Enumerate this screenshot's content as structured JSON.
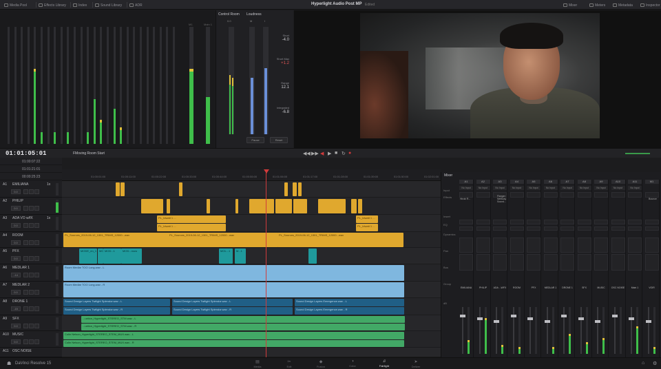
{
  "topbar": {
    "items": [
      "Media Pool",
      "Effects Library",
      "Index",
      "Sound Library",
      "ADR"
    ],
    "project_title": "Hyperlight Audio Post MP",
    "status": "Edited",
    "right_items": [
      "Mixer",
      "Meters",
      "Metadata",
      "Inspector"
    ]
  },
  "control_room": {
    "tab1": "Control Room",
    "tab2": "Loudness",
    "scale_top": "0.0",
    "m_label": "M",
    "i_label": "I",
    "short_label": "Short",
    "short_value": "-4.0",
    "short_max_label": "Short Max",
    "short_max_value": "+1.2",
    "range_label": "Range",
    "range_value": "12.1",
    "integrated_label": "Integrated",
    "integrated_value": "-6.8",
    "pause_label": "Pause",
    "reset_label": "Reset"
  },
  "meters": {
    "main_label": "M1",
    "bus_label": "Main 1"
  },
  "timeline": {
    "timecode": "01:01:05:01",
    "name": "FMoving Room Start",
    "tc_rows": [
      "01:00:07:22",
      "01:01:21:01",
      "00:00:25:23"
    ],
    "ruler": [
      "01:00:01:00",
      "01:00:11:00",
      "01:00:22:00",
      "01:00:33:00",
      "01:00:44:00",
      "01:00:55:00",
      "01:01:06:00",
      "01:01:17:00",
      "01:01:28:00",
      "01:01:39:00",
      "01:01:50:00",
      "01:02:01:00"
    ]
  },
  "tracks": [
    {
      "id": "A1",
      "name": "EMILIANA",
      "fmt": "1x",
      "vol": "0.0"
    },
    {
      "id": "A2",
      "name": "PHILIP",
      "fmt": "",
      "vol": "0.0"
    },
    {
      "id": "A3",
      "name": "ADA VO w/fX",
      "fmt": "1x",
      "vol": "0.0"
    },
    {
      "id": "A4",
      "name": "ROOM",
      "fmt": "",
      "vol": "0.0"
    },
    {
      "id": "A5",
      "name": "PFX",
      "fmt": "",
      "vol": "0.0"
    },
    {
      "id": "A6",
      "name": "MEDLAR 1",
      "fmt": "",
      "vol": "-14"
    },
    {
      "id": "A7",
      "name": "MEDLAR 2",
      "fmt": "",
      "vol": "0.0"
    },
    {
      "id": "A8",
      "name": "DRONE 1",
      "fmt": "",
      "vol": "-15"
    },
    {
      "id": "A9",
      "name": "SFX",
      "fmt": "",
      "vol": "0.0"
    },
    {
      "id": "A10",
      "name": "MUSIC",
      "fmt": "",
      "vol": "0.0"
    },
    {
      "id": "A11",
      "name": "OSC NOISE",
      "fmt": "",
      "vol": ""
    }
  ],
  "clips": {
    "a3": [
      "PL_Idwatt 1 ...",
      "PL_Idwatt 1 ...",
      "PL_Idwatt 1 ...",
      "PL_Idwatt 1 ..."
    ],
    "a4": [
      "PL_Sources_2019-06-12_1301_TRIMS_12000...wav",
      "PL_Sources_2019-06-12_1301_TRIMS_12000...wav",
      "PL_Sources_2019-06-12_1301_TRIMS_12000...wav"
    ],
    "a5": [
      "MODE_en_1",
      "MOl...1",
      "MOD...1",
      "MOD...mow",
      "MOL...1",
      "M...1"
    ],
    "a6": "Room Medlar TOO Long.wav - L",
    "a7": "Room Medlar TOO Long.wav - R",
    "a8": [
      "Sound Design Layers Twilight Splendor.wav - L",
      "Sound Design Layers Twilight Splendor.wav - L",
      "Sound Design Layers Emergence.wav - L",
      "Sound Design Layers Twilight Splendor.wav - R",
      "Sound Design Layers Twilight Splendor.wav - R",
      "Sound Design Layers Emergence.wav - R"
    ],
    "a9": [
      "...uxtion_Hyperlight_STEREO_STM.wav - L",
      "...uxtion_Hyperlight_STEREO_STM.wav - R"
    ],
    "a10": [
      "Colin Nelson_Hyperlight_STEREO_STEM_MUX.wav - L",
      "Colin Nelson_Hyperlight_STEREO_STEM_MUX.wav - R"
    ]
  },
  "mixer": {
    "title": "Mixer",
    "side_labels": [
      "Input",
      "Effects",
      "",
      "Insert",
      "EQ",
      "Dynamics",
      "Pan",
      "Bus",
      "",
      "Group",
      "dB"
    ],
    "channels": [
      {
        "hd": "A1",
        "inp": "No Input",
        "nm": "EMILIANA",
        "lvl": 0.25
      },
      {
        "hd": "A2",
        "inp": "No Input",
        "nm": "PHILIP",
        "lvl": 0.72
      },
      {
        "hd": "A3",
        "inp": "No Input",
        "nm": "ADA ...WFX",
        "lvl": 0.15
      },
      {
        "hd": "A4",
        "inp": "No Input",
        "nm": "ROOM",
        "lvl": 0.1
      },
      {
        "hd": "A5",
        "inp": "No Input",
        "nm": "PFX",
        "lvl": 0.0
      },
      {
        "hd": "A6",
        "inp": "No Input",
        "nm": "MEDLAR 1",
        "lvl": 0.1
      },
      {
        "hd": "A7",
        "inp": "No Input",
        "nm": "DRONE 1",
        "lvl": 0.38
      },
      {
        "hd": "A8",
        "inp": "No Input",
        "nm": "SFX",
        "lvl": 0.2
      },
      {
        "hd": "A9",
        "inp": "No Input",
        "nm": "MUSIC",
        "lvl": 0.3
      },
      {
        "hd": "A10",
        "inp": "No Input",
        "nm": "OSC NOISE",
        "lvl": 0.0
      },
      {
        "hd": "A11",
        "inp": "No Input",
        "nm": "Main 1",
        "lvl": 0.55
      },
      {
        "hd": "M1",
        "inp": "",
        "nm": "VOIR",
        "lvl": 0.1
      }
    ],
    "effects_label": "Hiroki R...",
    "effects_label2": "Flanger\nNetBusy\nSound...",
    "effects_label3": "Bounce"
  },
  "pagebar": {
    "app_name": "DaVinci Resolve 15",
    "tabs": [
      "Media",
      "Edit",
      "Fusion",
      "Color",
      "Fairlight",
      "Deliver"
    ],
    "active": "Fairlight"
  }
}
